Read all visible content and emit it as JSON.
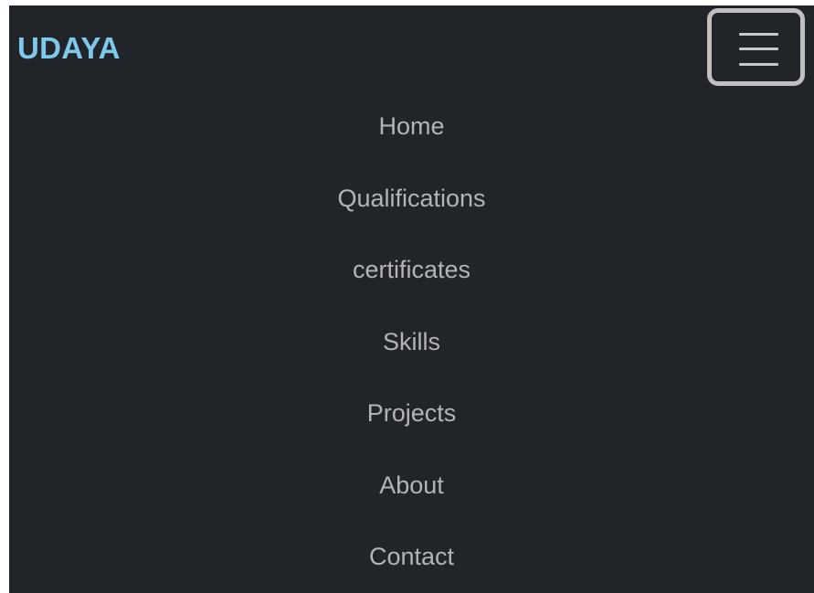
{
  "navbar": {
    "brand": "UDAYA",
    "toggler_icon": "hamburger-menu-icon",
    "items": [
      {
        "label": "Home"
      },
      {
        "label": "Qualifications"
      },
      {
        "label": "certificates"
      },
      {
        "label": "Skills"
      },
      {
        "label": "Projects"
      },
      {
        "label": "About"
      },
      {
        "label": "Contact"
      }
    ]
  },
  "colors": {
    "background": "#212429",
    "brand": "#7ec8ea",
    "link": "#b3b4b7",
    "toggler_border": "#c0c0c0"
  }
}
